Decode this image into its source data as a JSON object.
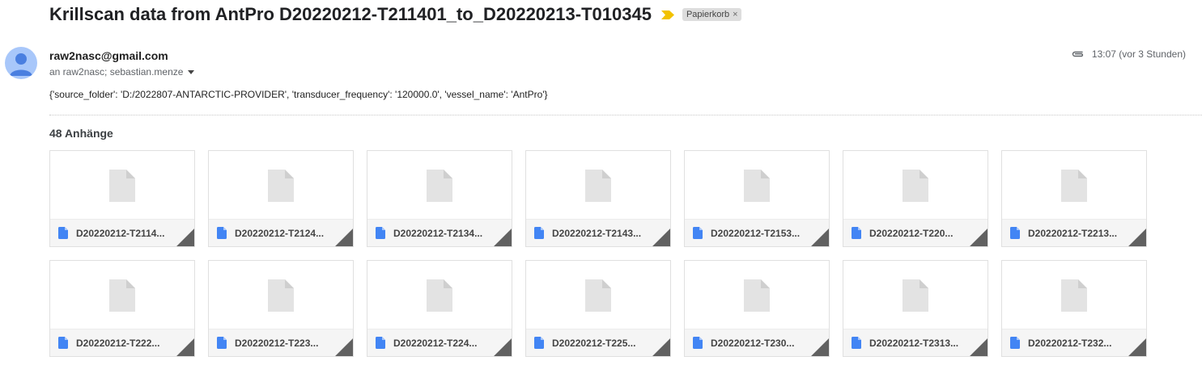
{
  "email": {
    "subject": "Krillscan data from AntPro D20220212-T211401_to_D20220213-T010345",
    "label": "Papierkorb",
    "label_remove": "×",
    "sender": "raw2nasc@gmail.com",
    "recipients": "an raw2nasc; sebastian.menze",
    "time": "13:07 (vor 3 Stunden)",
    "body": "{'source_folder': 'D:/2022807-ANTARCTIC-PROVIDER', 'transducer_frequency': '120000.0', 'vessel_name': 'AntPro'}"
  },
  "attachments": {
    "heading": "48 Anhänge",
    "items": [
      {
        "name": "D20220212-T2114..."
      },
      {
        "name": "D20220212-T2124..."
      },
      {
        "name": "D20220212-T2134..."
      },
      {
        "name": "D20220212-T2143..."
      },
      {
        "name": "D20220212-T2153..."
      },
      {
        "name": "D20220212-T220..."
      },
      {
        "name": "D20220212-T2213..."
      },
      {
        "name": "D20220212-T222..."
      },
      {
        "name": "D20220212-T223..."
      },
      {
        "name": "D20220212-T224..."
      },
      {
        "name": "D20220212-T225..."
      },
      {
        "name": "D20220212-T230..."
      },
      {
        "name": "D20220212-T2313..."
      },
      {
        "name": "D20220212-T232..."
      }
    ]
  },
  "colors": {
    "important_marker": "#f2c200",
    "file_icon": "#4285f4",
    "avatar_bg": "#a8c7fa",
    "avatar_fg": "#4a7fe0"
  },
  "icons": {
    "important": "important-marker-icon",
    "attachment": "paperclip-icon",
    "file": "document-icon",
    "expand": "chevron-down-icon"
  }
}
